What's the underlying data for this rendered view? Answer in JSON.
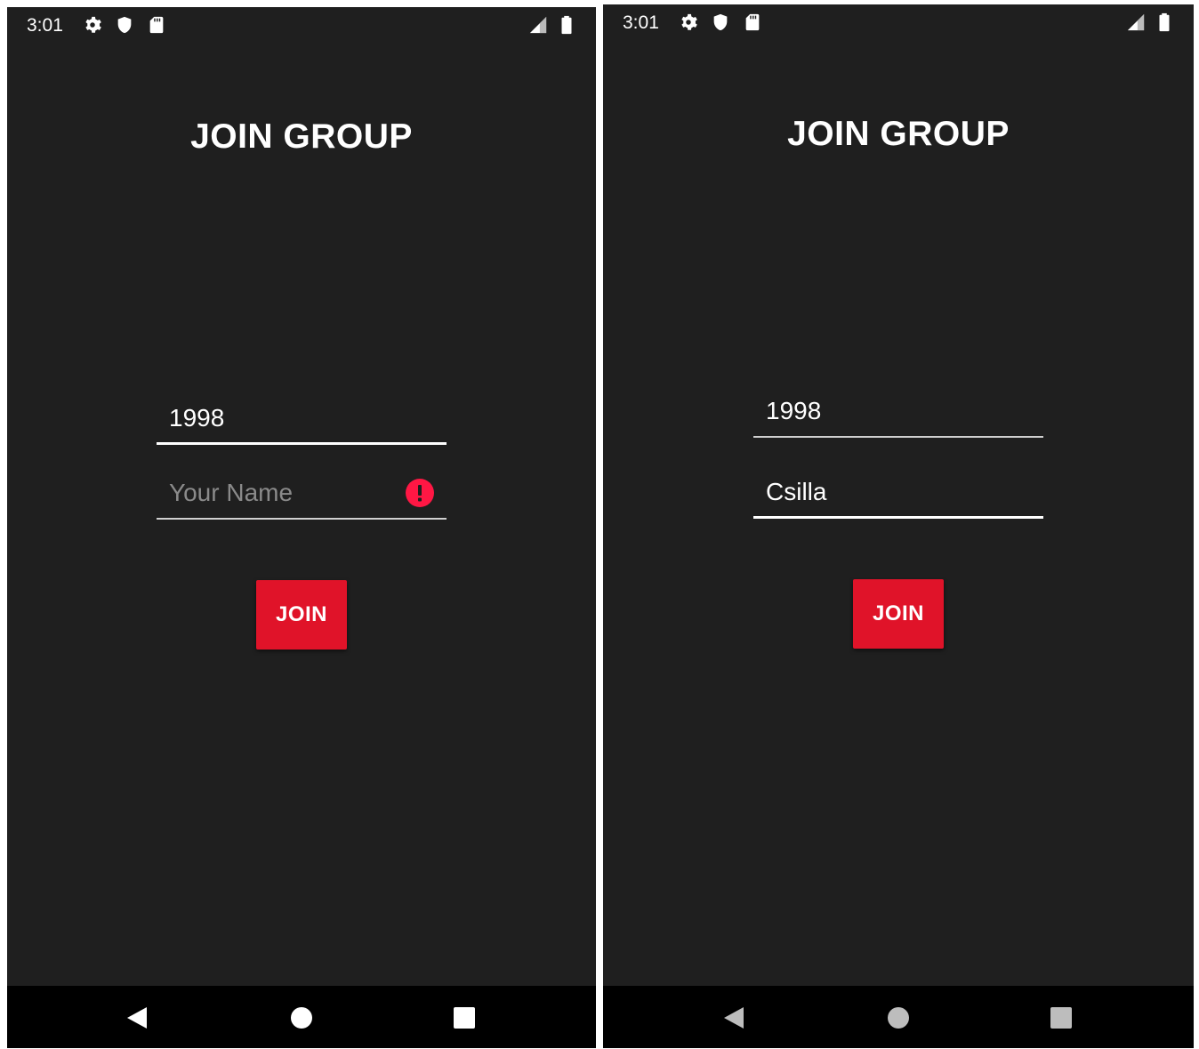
{
  "left_screen": {
    "status_bar": {
      "time": "3:01",
      "icons_left": [
        "gear-icon",
        "shield-icon",
        "sd-card-icon"
      ],
      "icons_right": [
        "signal-icon",
        "battery-icon"
      ]
    },
    "title": "JOIN GROUP",
    "group_field": {
      "value": "1998",
      "focused": true
    },
    "name_field": {
      "value": "",
      "placeholder": "Your Name",
      "error": true,
      "error_icon": "error-exclamation-icon"
    },
    "join_button": {
      "label": "JOIN"
    },
    "nav_bar": {
      "icons": [
        "back-icon",
        "home-icon",
        "recents-icon"
      ]
    }
  },
  "right_screen": {
    "status_bar": {
      "time": "3:01",
      "icons_left": [
        "gear-icon",
        "shield-icon",
        "sd-card-icon"
      ],
      "icons_right": [
        "signal-icon",
        "battery-icon"
      ]
    },
    "title": "JOIN GROUP",
    "group_field": {
      "value": "1998",
      "focused": false
    },
    "name_field": {
      "value": "Csilla",
      "focused": true
    },
    "join_button": {
      "label": "JOIN"
    },
    "nav_bar": {
      "icons": [
        "back-icon",
        "home-icon",
        "recents-icon"
      ]
    }
  },
  "colors": {
    "background": "#1f1f1f",
    "accent": "#e01329",
    "error": "#ff1744",
    "text": "#ffffff",
    "placeholder": "#8a8a8a",
    "nav_active": "#ffffff",
    "nav_inactive": "#bdbdbd"
  }
}
